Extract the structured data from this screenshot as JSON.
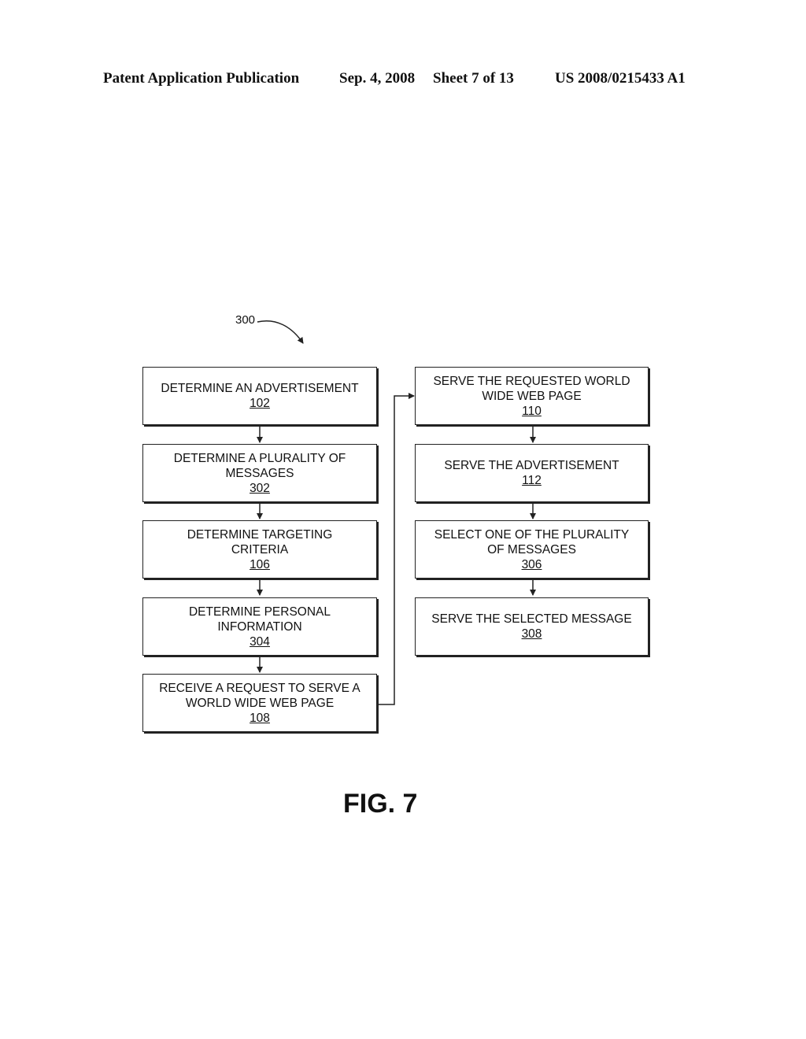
{
  "header": {
    "publication": "Patent Application Publication",
    "date": "Sep. 4, 2008",
    "sheet": "Sheet 7 of 13",
    "number": "US 2008/0215433 A1"
  },
  "diagram": {
    "reference": "300",
    "left_column": [
      {
        "lines": [
          "DETERMINE AN ADVERTISEMENT"
        ],
        "ref": "102"
      },
      {
        "lines": [
          "DETERMINE A PLURALITY OF",
          "MESSAGES"
        ],
        "ref": "302"
      },
      {
        "lines": [
          "DETERMINE TARGETING",
          "CRITERIA"
        ],
        "ref": "106"
      },
      {
        "lines": [
          "DETERMINE PERSONAL",
          "INFORMATION"
        ],
        "ref": "304"
      },
      {
        "lines": [
          "RECEIVE A REQUEST TO SERVE A",
          "WORLD WIDE WEB PAGE"
        ],
        "ref": "108"
      }
    ],
    "right_column": [
      {
        "lines": [
          "SERVE THE REQUESTED WORLD",
          "WIDE WEB PAGE"
        ],
        "ref": "110"
      },
      {
        "lines": [
          "SERVE THE ADVERTISEMENT"
        ],
        "ref": "112"
      },
      {
        "lines": [
          "SELECT ONE OF THE PLURALITY",
          "OF MESSAGES"
        ],
        "ref": "306"
      },
      {
        "lines": [
          "SERVE THE SELECTED MESSAGE"
        ],
        "ref": "308"
      }
    ]
  },
  "figure_label": "FIG. 7"
}
